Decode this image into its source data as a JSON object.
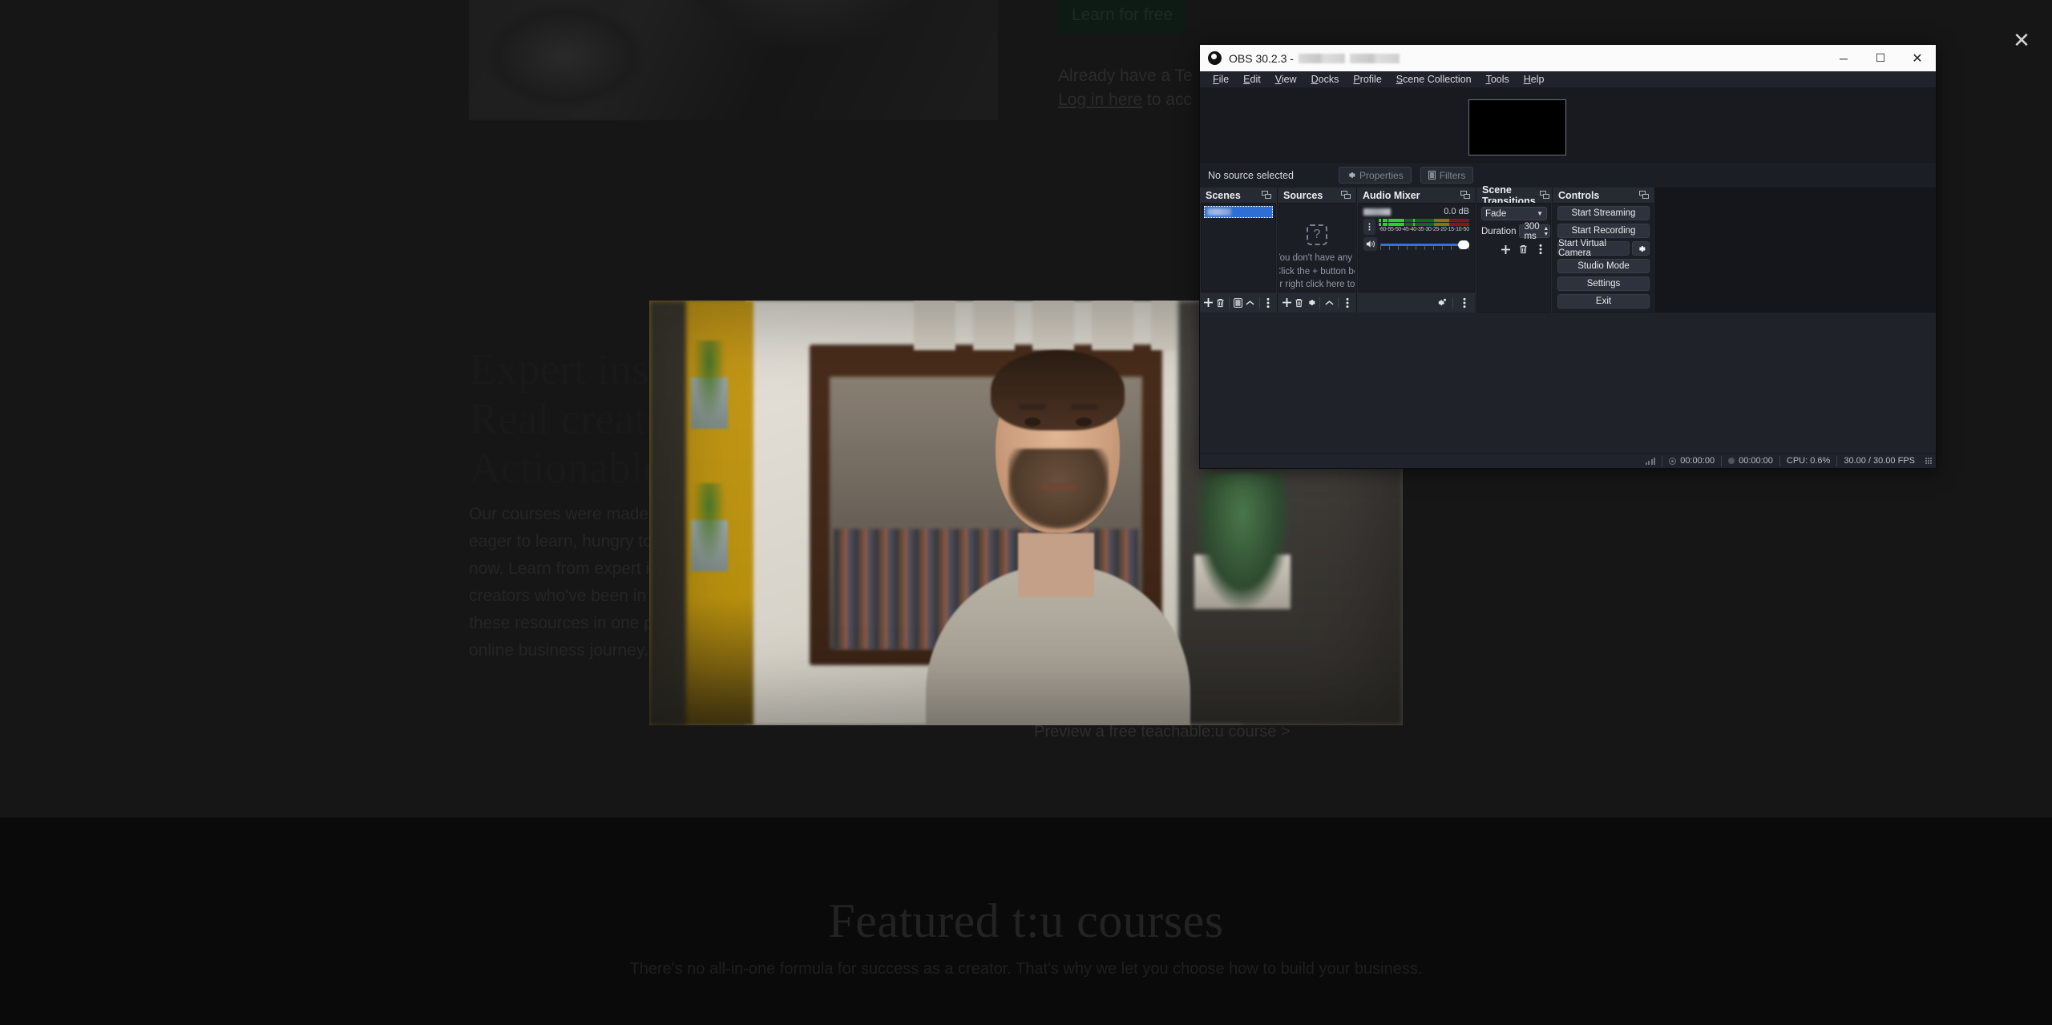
{
  "background": {
    "cta_button": "Learn for free",
    "already_text": "Already have a Te",
    "login_link": "Log in here",
    "login_rest": " to acc",
    "headline_lines": [
      "Expert inst",
      "Real creato",
      "Actionable"
    ],
    "body_lines": [
      "Our courses were made f",
      "eager to learn, hungry to",
      "now. Learn from expert in",
      "creators who've been in y",
      "these resources in one pl",
      "online business journey."
    ],
    "preview_link": "Preview a free teachable:u course >",
    "featured_title": "Featured t:u courses",
    "featured_subtitle": "There's no all-in-one formula for success as a creator. That's why we let you choose how to build your business.",
    "close_glyph": "✕"
  },
  "obs": {
    "title": "OBS 30.2.3 -",
    "window_buttons": {
      "minimize": "─",
      "maximize": "☐",
      "close": "✕"
    },
    "menu": [
      {
        "label": "File",
        "mnemonic": "F"
      },
      {
        "label": "Edit",
        "mnemonic": "E"
      },
      {
        "label": "View",
        "mnemonic": "V"
      },
      {
        "label": "Docks",
        "mnemonic": "D"
      },
      {
        "label": "Profile",
        "mnemonic": "P"
      },
      {
        "label": "Scene Collection",
        "mnemonic": "S"
      },
      {
        "label": "Tools",
        "mnemonic": "T"
      },
      {
        "label": "Help",
        "mnemonic": "H"
      }
    ],
    "source_bar": {
      "status": "No source selected",
      "properties_label": "Properties",
      "filters_label": "Filters"
    },
    "docks": {
      "scenes": {
        "title": "Scenes",
        "items": [
          {
            "name": "",
            "selected": true
          }
        ]
      },
      "sources": {
        "title": "Sources",
        "empty_lines": [
          "You don't have any sources.",
          "Click the + button below,",
          "or right click here to add one."
        ],
        "empty_icon": "?"
      },
      "audio_mixer": {
        "title": "Audio Mixer",
        "channel_name": "",
        "db_value": "0.0 dB",
        "scale_labels": [
          "-60",
          "-55",
          "-50",
          "-45",
          "-40",
          "-35",
          "-30",
          "-25",
          "-20",
          "-15",
          "-10",
          "-5",
          "0"
        ],
        "volume_percent": 100,
        "meter_level_db": -42
      },
      "scene_transitions": {
        "title": "Scene Transitions",
        "selected_transition": "Fade",
        "duration_label": "Duration",
        "duration_value": "300 ms"
      },
      "controls": {
        "title": "Controls",
        "buttons": [
          "Start Streaming",
          "Start Recording",
          "Start Virtual Camera",
          "Studio Mode",
          "Settings",
          "Exit"
        ]
      }
    },
    "status_bar": {
      "stream_time": "00:00:00",
      "record_time": "00:00:00",
      "cpu": "CPU: 0.6%",
      "fps": "30.00 / 30.00 FPS"
    }
  },
  "colors": {
    "accent_blue": "#2f6ed4",
    "dock_bg": "#262a33",
    "panel_bg": "#1b1e25",
    "titlebar": "#fbfbfb",
    "meter_green": "#26d426",
    "meter_green_dark": "#14661b",
    "meter_yellow": "#8a7410",
    "meter_red": "#8a1414"
  }
}
